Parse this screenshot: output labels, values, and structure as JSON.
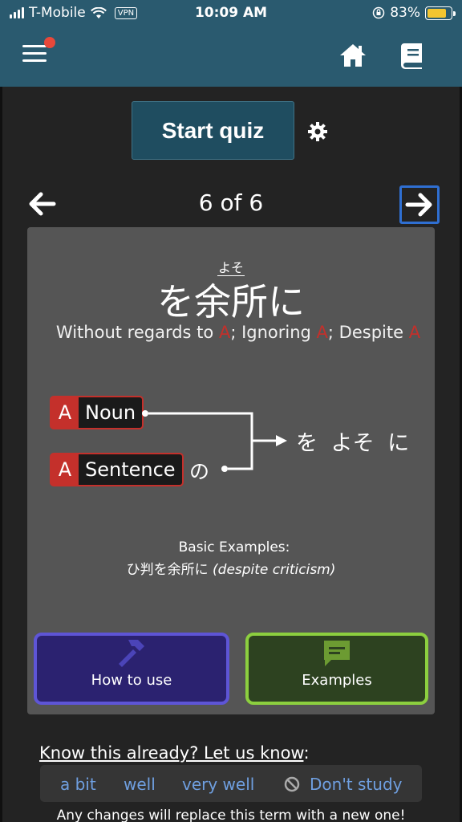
{
  "status_bar": {
    "carrier": "T-Mobile",
    "vpn": "VPN",
    "time": "10:09 AM",
    "battery": "83%",
    "battery_level": 0.83,
    "battery_color": "#f3c530"
  },
  "header": {
    "bg_color": "#2a5a6f",
    "menu_icon": "hamburger-icon",
    "notification_dot_color": "#e8483a",
    "home_icon": "home-icon",
    "book_icon": "book-icon"
  },
  "quiz": {
    "start_label": "Start quiz",
    "settings_icon": "gear-icon"
  },
  "pager": {
    "counter": "6 of 6",
    "prev_icon": "arrow-left-icon",
    "next_icon": "arrow-right-icon"
  },
  "card": {
    "furigana": "よそ",
    "term": "を余所に",
    "meaning_1": "Without regards to ",
    "meaning_a1": "A",
    "meaning_2": "; Ignoring ",
    "meaning_a2": "A",
    "meaning_3": "; Despite ",
    "meaning_a3": "A",
    "pattern": {
      "row1_letter": "A",
      "row1_label": "Noun",
      "row2_letter": "A",
      "row2_label": "Sentence",
      "row2_particle": "の",
      "result": "を よそ に"
    },
    "examples_heading": "Basic Examples:",
    "example_jp": "ひ判を余所に",
    "example_en": "(despite criticism)",
    "how_to_use_label": "How to use",
    "how_to_use_icon": "hammer-icon",
    "examples_label": "Examples",
    "examples_icon": "chat-bubble-icon"
  },
  "know": {
    "prompt_link": "Know this already? Let us know",
    "prompt_colon": ":",
    "options": [
      "a bit",
      "well",
      "very well",
      "Don't study"
    ],
    "dont_study_icon": "ban-icon",
    "footer": "Any changes will replace this term with a new one!"
  }
}
